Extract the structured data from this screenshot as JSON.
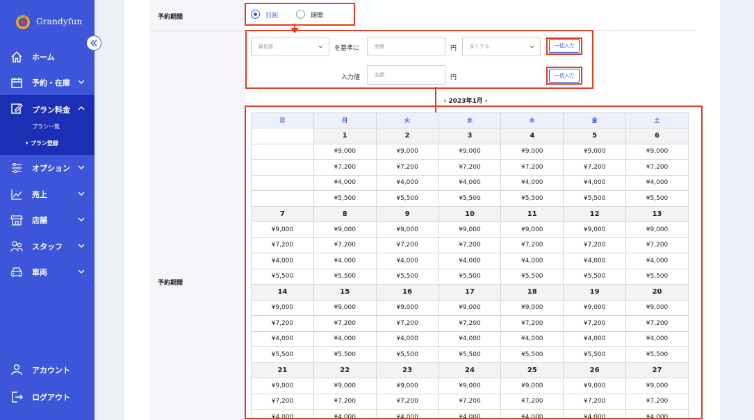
{
  "app": {
    "logo_text": "Grandyfun"
  },
  "sidebar": {
    "items": [
      {
        "label": "ホーム",
        "icon": "home-icon"
      },
      {
        "label": "予約・在庫",
        "icon": "calendar-icon"
      },
      {
        "label": "プラン料金",
        "icon": "edit-icon"
      },
      {
        "label": "オプション",
        "icon": "sliders-icon"
      },
      {
        "label": "売上",
        "icon": "chart-line-icon"
      },
      {
        "label": "店舗",
        "icon": "store-icon"
      },
      {
        "label": "スタッフ",
        "icon": "users-icon"
      },
      {
        "label": "車両",
        "icon": "car-icon"
      }
    ],
    "sub_items": [
      "プラン一覧",
      "• プラン登録"
    ],
    "bottom": [
      {
        "label": "アカウント",
        "icon": "user-icon"
      },
      {
        "label": "ログアウト",
        "icon": "logout-icon"
      }
    ],
    "accent_color": "#3c55d9",
    "active_color": "#1b2fb5"
  },
  "form": {
    "period_label": "予約期間",
    "radio_daily": "日別",
    "radio_range": "期間",
    "base_select": "最低値",
    "base_suffix": "を基準に",
    "amount_placeholder": "金額",
    "yen": "円",
    "adjust_select": "安くする",
    "bulk_button": "一括入力",
    "input_value_label": "入力値",
    "month": "2023年1月",
    "calendar_label": "予約期間"
  },
  "calendar": {
    "weekdays": [
      "日",
      "月",
      "火",
      "水",
      "木",
      "金",
      "土"
    ],
    "weeks": [
      {
        "days": [
          "",
          "1",
          "2",
          "3",
          "4",
          "5",
          "6"
        ]
      },
      {
        "days": [
          "7",
          "8",
          "9",
          "10",
          "11",
          "12",
          "13"
        ]
      },
      {
        "days": [
          "14",
          "15",
          "16",
          "17",
          "18",
          "19",
          "20"
        ]
      },
      {
        "days": [
          "21",
          "22",
          "23",
          "24",
          "25",
          "26",
          "27"
        ]
      }
    ],
    "prices": [
      "¥9,000",
      "¥7,200",
      "¥4,000",
      "¥5,500"
    ]
  },
  "colors": {
    "highlight": "#e13b21"
  }
}
